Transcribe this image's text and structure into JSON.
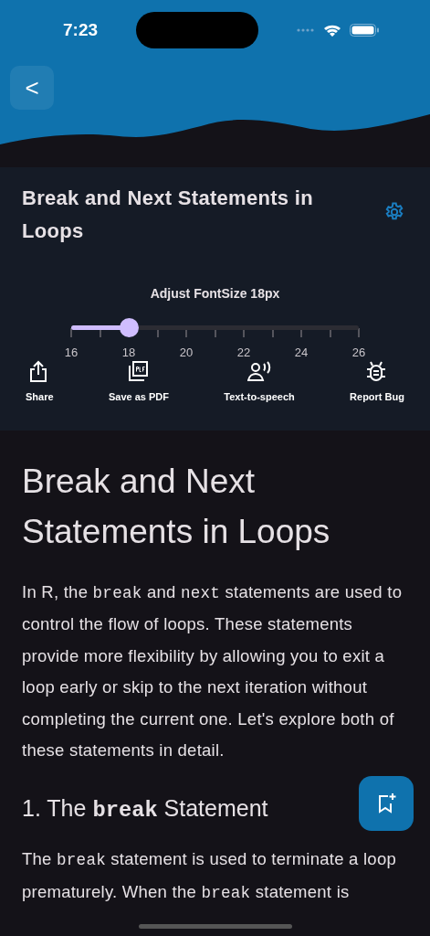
{
  "status_bar": {
    "time": "7:23"
  },
  "header": {
    "back_label": "<"
  },
  "panel": {
    "title": "Break and Next Statements in Loops",
    "slider": {
      "label": "Adjust FontSize 18px",
      "level": 0.2,
      "ticks": [
        "16",
        "18",
        "20",
        "22",
        "24",
        "26"
      ]
    },
    "actions": [
      {
        "kind": "share",
        "label": "Share"
      },
      {
        "kind": "pdf",
        "label": "Save as PDF"
      },
      {
        "kind": "speech",
        "label": "Text-to-speech"
      },
      {
        "kind": "bug",
        "label": "Report Bug"
      }
    ]
  },
  "article": [
    {
      "kind": "h1",
      "parts": [
        {
          "kind": "text",
          "text": "Break and Next Statements in Loops"
        }
      ]
    },
    {
      "kind": "p",
      "parts": [
        {
          "kind": "text",
          "text": "In R, the "
        },
        {
          "kind": "code",
          "text": "break"
        },
        {
          "kind": "text",
          "text": " and "
        },
        {
          "kind": "code",
          "text": "next"
        },
        {
          "kind": "text",
          "text": " statements are used to control the flow of loops. These statements provide more flexibility by allowing you to exit a loop early or skip to the next iteration without completing the current one. Let's explore both of these statements in detail."
        }
      ]
    },
    {
      "kind": "h2",
      "parts": [
        {
          "kind": "text",
          "text": "1. The "
        },
        {
          "kind": "code",
          "text": "break"
        },
        {
          "kind": "text",
          "text": " Statement"
        }
      ]
    },
    {
      "kind": "p",
      "parts": [
        {
          "kind": "text",
          "text": "The "
        },
        {
          "kind": "code",
          "text": "break"
        },
        {
          "kind": "text",
          "text": " statement is used to terminate a loop prematurely. When the "
        },
        {
          "kind": "code",
          "text": "break"
        },
        {
          "kind": "text",
          "text": " statement is"
        }
      ]
    }
  ]
}
